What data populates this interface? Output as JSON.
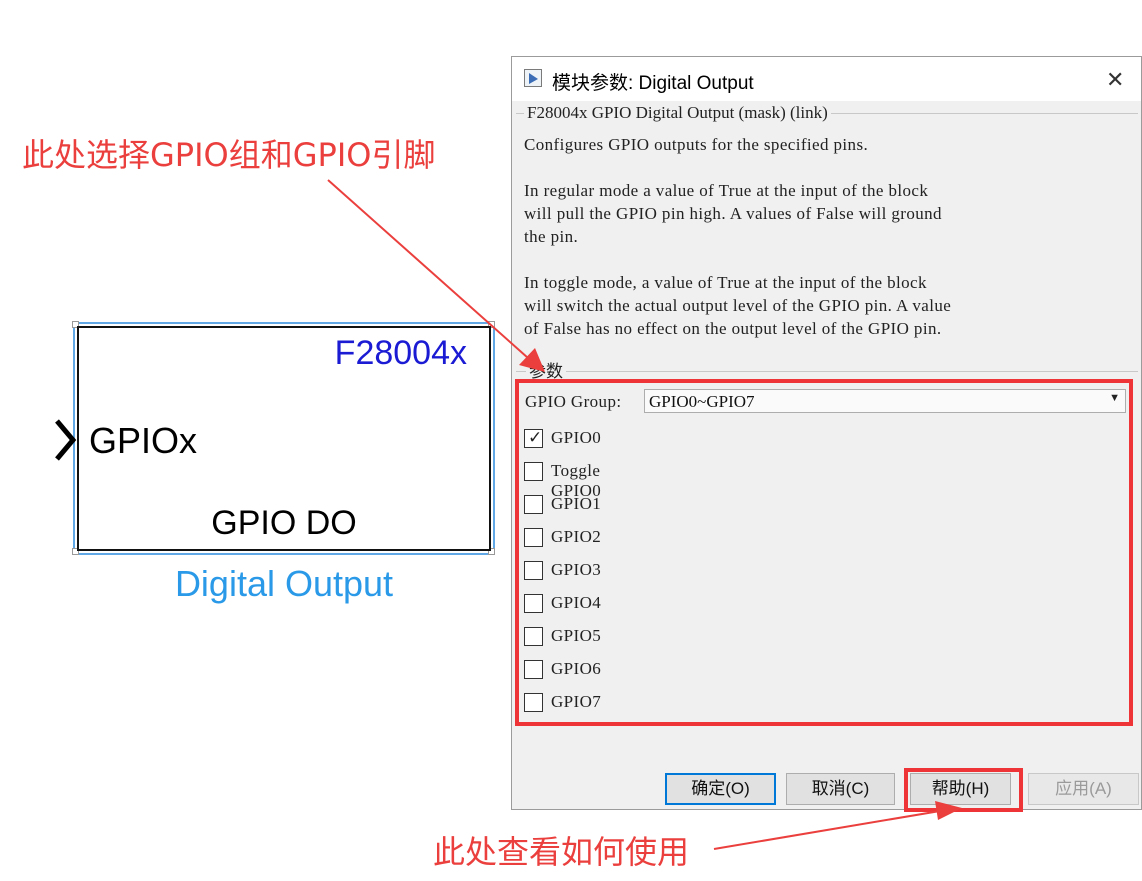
{
  "block": {
    "chip_label": "F28004x",
    "input_port_label": "GPIOx",
    "function_label": "GPIO DO",
    "name": "Digital Output"
  },
  "dialog": {
    "title": "模块参数: Digital Output",
    "description_legend": "F28004x GPIO Digital Output (mask) (link)",
    "description": "Configures GPIO outputs for the specified pins.\n\nIn regular mode a value of True at the input of the block\nwill pull the GPIO pin high. A values of False will ground\nthe pin.\n\nIn toggle mode, a value of True at the input of the block\nwill switch the actual output level of the GPIO pin. A value\nof False has no effect on the output level of the GPIO pin.",
    "params_legend": "参数",
    "gpio_group_label": "GPIO Group:",
    "gpio_group_value": "GPIO0~GPIO7",
    "checkboxes": [
      {
        "label": "GPIO0",
        "checked": true
      },
      {
        "label": "Toggle GPIO0",
        "checked": false
      },
      {
        "label": "GPIO1",
        "checked": false
      },
      {
        "label": "GPIO2",
        "checked": false
      },
      {
        "label": "GPIO3",
        "checked": false
      },
      {
        "label": "GPIO4",
        "checked": false
      },
      {
        "label": "GPIO5",
        "checked": false
      },
      {
        "label": "GPIO6",
        "checked": false
      },
      {
        "label": "GPIO7",
        "checked": false
      }
    ],
    "buttons": {
      "ok": "确定(O)",
      "cancel": "取消(C)",
      "help": "帮助(H)",
      "apply": "应用(A)"
    }
  },
  "annotations": {
    "select_note": "此处选择GPIO组和GPIO引脚",
    "help_note": "此处查看如何使用",
    "color": "#ea3f3d"
  }
}
